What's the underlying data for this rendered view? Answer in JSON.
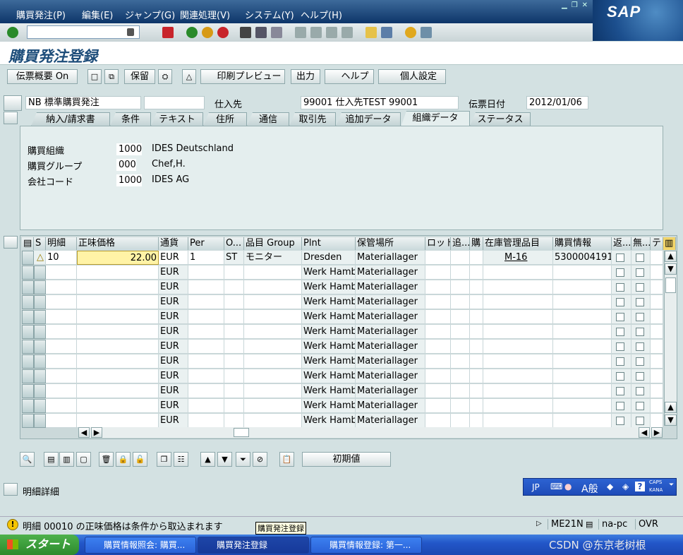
{
  "menu": [
    "購買発注(P)",
    "編集(E)",
    "ジャンプ(G)",
    "関連処理(V)",
    "システム(Y)",
    "ヘルプ(H)"
  ],
  "brand": {
    "logo": "SAP"
  },
  "page_title": "購買発注登録",
  "app_toolbar": {
    "doc_overview": "伝票概要 On",
    "hold": "保留",
    "print_preview": "印刷プレビュー",
    "output": "出力",
    "help": "ヘルプ",
    "personal_settings": "個人設定"
  },
  "header": {
    "doc_type": "NB 標準購買発注",
    "vendor_label": "仕入先",
    "vendor_value": "99001 仕入先TEST 99001",
    "doc_date_label": "伝票日付",
    "doc_date_value": "2012/01/06"
  },
  "tabs": [
    "納入/請求書",
    "条件",
    "テキスト",
    "住所",
    "通信",
    "取引先",
    "追加データ",
    "組織データ",
    "ステータス"
  ],
  "active_tab": "組織データ",
  "org_data": {
    "purch_org_label": "購買組織",
    "purch_org_value": "1000",
    "purch_org_desc": "IDES Deutschland",
    "purch_group_label": "購買グループ",
    "purch_group_value": "000",
    "purch_group_desc": "Chef,H.",
    "company_code_label": "会社コード",
    "company_code_value": "1000",
    "company_code_desc": "IDES AG"
  },
  "grid": {
    "columns": [
      "S",
      "明細",
      "正味価格",
      "通貨",
      "Per",
      "O...",
      "品目 Group",
      "Plnt",
      "保管場所",
      "ロット",
      "追...",
      "購",
      "在庫管理品目",
      "購買情報",
      "返...",
      "無...",
      "テ"
    ],
    "first_row": {
      "status": "△",
      "item": "10",
      "net_price": "22.00",
      "currency": "EUR",
      "per": "1",
      "unit": "ST",
      "material_group": "モニター",
      "plant": "Dresden",
      "storage_location": "Materiallager",
      "stock_item": "M-16",
      "info_record": "5300004191"
    },
    "other_rows": {
      "currency": "EUR",
      "plant": "Werk Hamburg",
      "storage_location": "Materiallager",
      "count": 11
    }
  },
  "bottom": {
    "default_values": "初期値",
    "item_detail": "明細詳細"
  },
  "ime": {
    "lang": "JP",
    "mode": "A般",
    "caps": "CAPS",
    "kana": "KANA"
  },
  "status": {
    "message": "明細 00010 の正味価格は条件から取込まれます",
    "tooltip": "購買発注登録",
    "tcode": "ME21N",
    "host": "na-pc",
    "mode": "OVR"
  },
  "taskbar": {
    "start": "スタート",
    "tasks": [
      "購買情報照会: 購買...",
      "購買発注登録",
      "購買情報登録: 第一..."
    ],
    "watermark": "CSDN @东京老树根"
  }
}
